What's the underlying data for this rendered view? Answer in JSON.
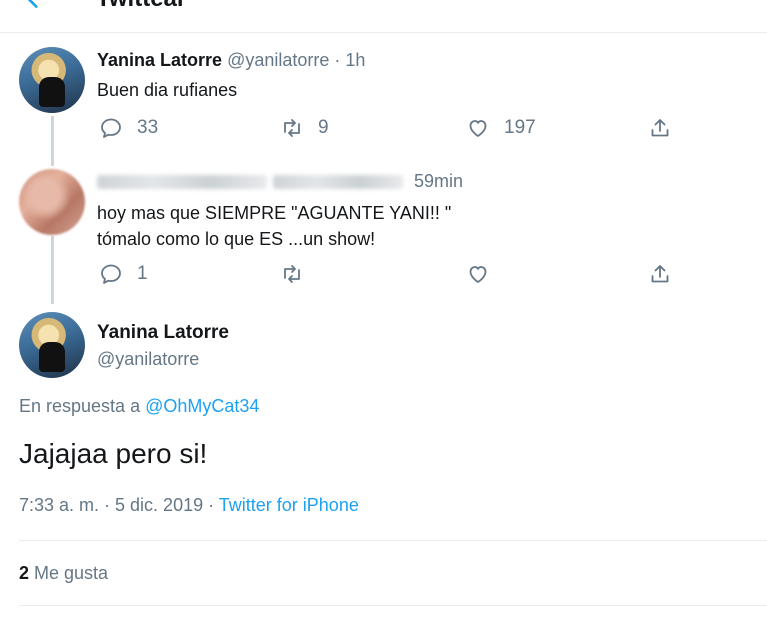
{
  "header": {
    "title": "Twittear",
    "back_icon": "back-arrow-icon"
  },
  "tweets": [
    {
      "name": "Yanina Latorre",
      "handle": "@yanilatorre",
      "time": " · 1h",
      "text": "Buen dia rufianes",
      "actions": {
        "reply": "33",
        "retweet": "9",
        "like": "197"
      }
    },
    {
      "name": "",
      "handle": "",
      "time": "59min",
      "text_lines": [
        "hoy mas que SIEMPRE \"AGUANTE YANI!! \"",
        "tómalo como lo que ES ...un show!"
      ],
      "actions": {
        "reply": "1",
        "retweet": "",
        "like": ""
      }
    }
  ],
  "main_tweet": {
    "name": "Yanina Latorre",
    "handle": "@yanilatorre",
    "reply_prefix": "En respuesta a ",
    "reply_to": "@OhMyCat34",
    "text": "Jajajaa pero si!",
    "timestamp": "7:33 a. m. · 5 dic. 2019 · ",
    "source": "Twitter for iPhone",
    "likes_count": "2",
    "likes_label": " Me gusta"
  },
  "colors": {
    "accent": "#1da1f2",
    "muted": "#657786",
    "text": "#14171a",
    "divider": "#e6ecf0"
  }
}
